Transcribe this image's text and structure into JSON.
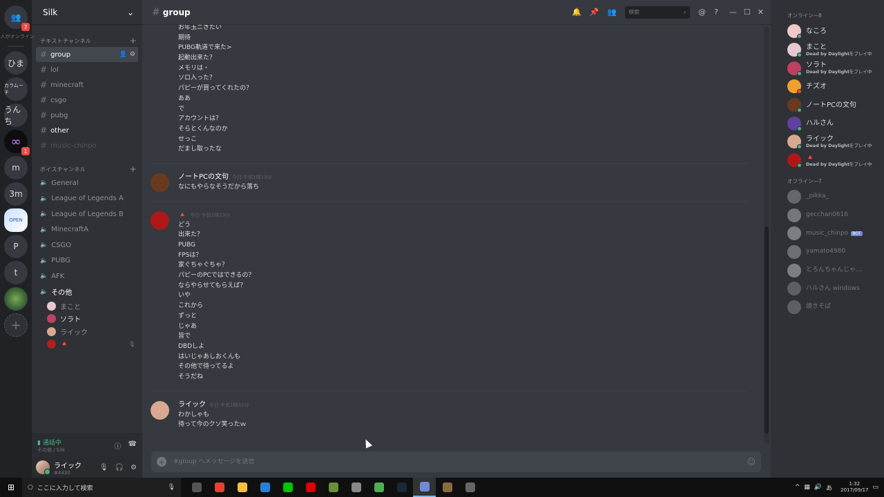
{
  "rail": {
    "online_caption": "8人がオンライン",
    "home_badge": "7",
    "servers": [
      {
        "label": "ひま",
        "badge": ""
      },
      {
        "label": "カラムーチ",
        "badge": ""
      },
      {
        "label": "うんち",
        "badge": ""
      },
      {
        "label": "∞",
        "badge": "1"
      },
      {
        "label": "m",
        "badge": ""
      },
      {
        "label": "3m",
        "badge": ""
      },
      {
        "label": "OPEN",
        "badge": ""
      },
      {
        "label": "P",
        "badge": ""
      },
      {
        "label": "t",
        "badge": ""
      },
      {
        "label": "",
        "badge": ""
      }
    ],
    "add_label": "+"
  },
  "guild": {
    "name": "Silk",
    "text_category": "テキストチャンネル",
    "voice_category": "ボイスチャンネル",
    "text_channels": [
      {
        "name": "group",
        "state": "active"
      },
      {
        "name": "lol",
        "state": ""
      },
      {
        "name": "minecraft",
        "state": ""
      },
      {
        "name": "csgo",
        "state": ""
      },
      {
        "name": "pubg",
        "state": ""
      },
      {
        "name": "other",
        "state": "unread"
      },
      {
        "name": "music-chinpo",
        "state": "muted"
      }
    ],
    "voice_channels": [
      {
        "name": "General",
        "bright": false
      },
      {
        "name": "League of Legends A",
        "bright": false
      },
      {
        "name": "League of Legends B",
        "bright": false
      },
      {
        "name": "MinecraftA",
        "bright": false
      },
      {
        "name": "CSGO",
        "bright": false
      },
      {
        "name": "PUBG",
        "bright": false
      },
      {
        "name": "AFK",
        "bright": false
      },
      {
        "name": "その他",
        "bright": true
      }
    ],
    "voice_users": [
      {
        "name": "まこと",
        "bright": false,
        "color": "#e8c8d0"
      },
      {
        "name": "ソラト",
        "bright": true,
        "color": "#c04060"
      },
      {
        "name": "ライック",
        "bright": false,
        "color": "#d8a890"
      },
      {
        "name": "🔺",
        "bright": false,
        "color": "#b02020"
      }
    ]
  },
  "voice_panel": {
    "state": "通話中",
    "sub": "その他 / Silk"
  },
  "user_panel": {
    "name": "ライック",
    "tag": "#4430"
  },
  "channel": {
    "title": "group",
    "search_placeholder": "検索"
  },
  "messages": [
    {
      "author": "",
      "time": "",
      "avatar": "",
      "lines": [
        "お年玉ニきたい",
        "期待",
        "PUBG軌道で来た>",
        "起動出来た？",
        "メモリは・",
        "ソロ入った？",
        "パピーが買ってくれたの？",
        "ああ",
        "で",
        "アカウントは？",
        "そらとくんなのか",
        "せっこ",
        "だまし取ったな"
      ]
    },
    {
      "author": "ノートPCの文句",
      "time": "今日 午前1時19分",
      "avatar": "#6a3a20",
      "lines": [
        "なにもやらなそうだから落ち"
      ]
    },
    {
      "author": "🔺",
      "time": "今日 午前1時23分",
      "avatar": "#b01818",
      "lines": [
        "どう",
        "出来た？",
        "PUBG",
        "FPSは？",
        "家ぐちゃぐちゃ？",
        "パピーのPCではできるの？",
        "ならやらせてもらえば？",
        "いや",
        "これから",
        "ずっと",
        "じゃあ",
        "皆で",
        "DBDしよ",
        "はいじゃあしおくんも",
        "その他で待ってるよ",
        "そうだね"
      ]
    },
    {
      "author": "ライック",
      "time": "今日 午前1時32分",
      "avatar": "#d8a890",
      "lines": [
        "わかしゃも",
        "待って今のクソ笑ったｗ"
      ]
    }
  ],
  "composer": {
    "placeholder": "#group へメッセージを送信"
  },
  "members": {
    "online_label": "オンライン—8",
    "offline_label": "オフライン—7",
    "online": [
      {
        "name": "なころ",
        "activity_game": "",
        "activity_suffix": "",
        "color": "#f0c8c8",
        "status": "#43b581"
      },
      {
        "name": "まこと",
        "activity_game": "Dead by Daylight",
        "activity_suffix": "をプレイ中",
        "color": "#e8c8d0",
        "status": "#43b581"
      },
      {
        "name": "ソラト",
        "activity_game": "Dead by Daylight",
        "activity_suffix": "をプレイ中",
        "color": "#c04060",
        "status": "#43b581"
      },
      {
        "name": "チズオ",
        "activity_game": "",
        "activity_suffix": "",
        "color": "#f0a030",
        "status": "#f04747"
      },
      {
        "name": "ノートPCの文句",
        "activity_game": "",
        "activity_suffix": "",
        "color": "#6a3a20",
        "status": "#43b581"
      },
      {
        "name": "ハルさん",
        "activity_game": "",
        "activity_suffix": "",
        "color": "#6040a0",
        "status": "#43b581"
      },
      {
        "name": "ライック",
        "activity_game": "Dead by Daylight",
        "activity_suffix": "をプレイ中",
        "color": "#d8a890",
        "status": "#43b581"
      },
      {
        "name": "🔺",
        "activity_game": "Dead by Daylight",
        "activity_suffix": "をプレイ中",
        "color": "#b01818",
        "status": "#43b581"
      }
    ],
    "offline": [
      {
        "name": "_pikka_",
        "bot": false,
        "color": "#aaaaaa"
      },
      {
        "name": "gecchan0616",
        "bot": false,
        "color": "#cccccc"
      },
      {
        "name": "music_chinpo",
        "bot": true,
        "bot_label": "BOT",
        "color": "#dddddd"
      },
      {
        "name": "yamato4980",
        "bot": false,
        "color": "#bbbbbb"
      },
      {
        "name": "とろんちゃんじゃ…",
        "bot": false,
        "color": "#dddddd"
      },
      {
        "name": "ハルさん windows",
        "bot": false,
        "color": "#999999"
      },
      {
        "name": "焼きそば",
        "bot": false,
        "color": "#999999"
      }
    ]
  },
  "taskbar": {
    "search_placeholder": "ここに入力して検索",
    "apps": [
      {
        "name": "task-view",
        "color": "#555555"
      },
      {
        "name": "chrome",
        "color": "#e34133"
      },
      {
        "name": "explorer",
        "color": "#f3c13a"
      },
      {
        "name": "app-blue",
        "color": "#2a7fd4"
      },
      {
        "name": "line",
        "color": "#00c300"
      },
      {
        "name": "recorder",
        "color": "#e00000"
      },
      {
        "name": "minecraft",
        "color": "#6b8e3a"
      },
      {
        "name": "app-diamond",
        "color": "#888888"
      },
      {
        "name": "app-green",
        "color": "#4caf50"
      },
      {
        "name": "steam",
        "color": "#1b2838"
      },
      {
        "name": "discord",
        "color": "#7289da"
      },
      {
        "name": "app-brown",
        "color": "#8a6a40"
      },
      {
        "name": "app-gray",
        "color": "#666666"
      }
    ],
    "ime": "あ",
    "time": "1:32",
    "date": "2017/09/17"
  }
}
